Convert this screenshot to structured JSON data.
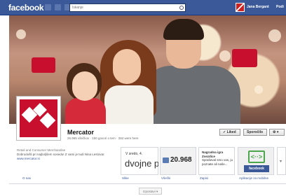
{
  "topbar": {
    "logo": "facebook",
    "search_placeholder": "Iskanje",
    "user_name": "Jana Bergant",
    "home_label": "Podi"
  },
  "page": {
    "title": "Mercator",
    "subtitle": "26.965 všečkov · 150 govori o tem · 284 were here",
    "actions": {
      "liked": "✓ Liked",
      "message": "Sporočilo",
      "settings": "⚙ ▾"
    }
  },
  "about": {
    "category": "Retail and Consumer Merchandise",
    "description": "Dobrodošli pri najboljšem sosedu! Z vami je tudi Nina Lestovar.",
    "website": "www.mercator.si",
    "link_label": "O nas"
  },
  "apps": [
    {
      "label": "Slike",
      "date_top": "V sredo, 4.",
      "date_big": "dvojne p"
    },
    {
      "label": "Všečki",
      "likes": "20.968"
    },
    {
      "label": "Zapisi",
      "prize_title": "Nagradna igra Zvezdice",
      "prize_text": "Spraševal smo vas, ju poznate ali naše..."
    },
    {
      "label": "Aplikacije za mobilne",
      "badge": "facebook",
      "arrows": "<··>"
    }
  ],
  "bottom": {
    "button": "Izpostavi ▾"
  }
}
